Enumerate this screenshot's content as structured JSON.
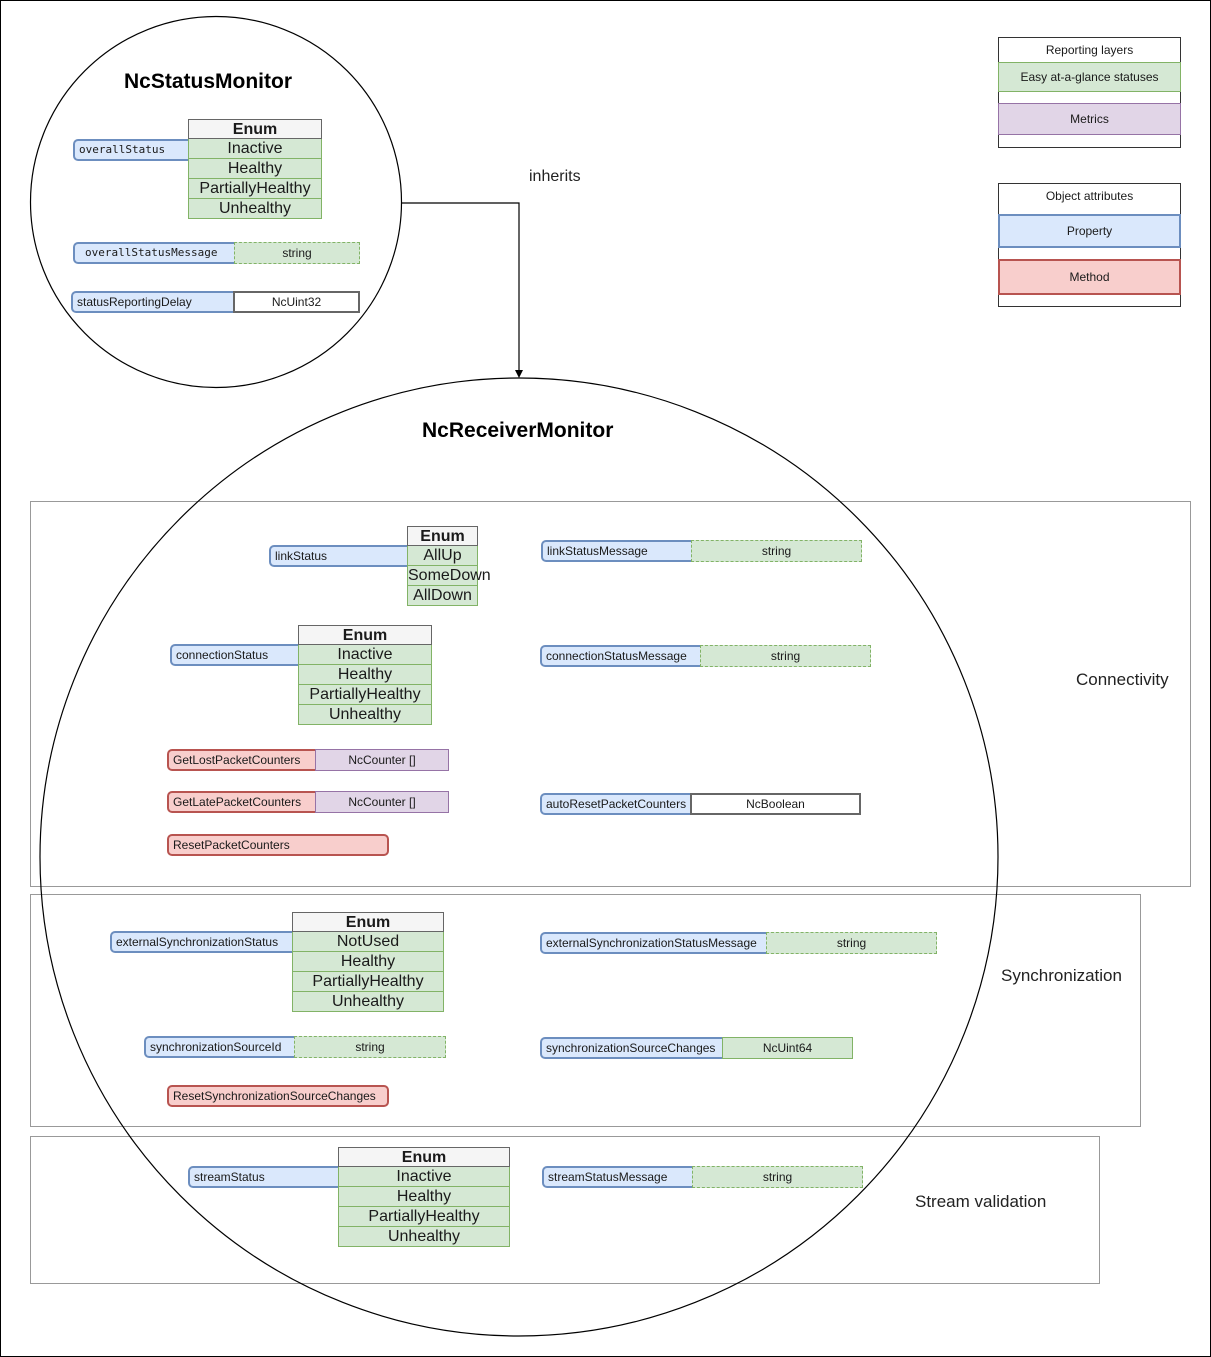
{
  "diagram": {
    "inherits_label": "inherits",
    "base_class": {
      "title": "NcStatusMonitor",
      "overallStatus": {
        "name": "overallStatus",
        "enum_header": "Enum",
        "values": [
          "Inactive",
          "Healthy",
          "PartiallyHealthy",
          "Unhealthy"
        ]
      },
      "overallStatusMessage": {
        "name": "overallStatusMessage",
        "type": "string"
      },
      "statusReportingDelay": {
        "name": "statusReportingDelay",
        "type": "NcUint32"
      }
    },
    "derived_class": {
      "title": "NcReceiverMonitor",
      "sections": {
        "connectivity": {
          "label": "Connectivity",
          "linkStatus": {
            "name": "linkStatus",
            "enum_header": "Enum",
            "values": [
              "AllUp",
              "SomeDown",
              "AllDown"
            ]
          },
          "linkStatusMessage": {
            "name": "linkStatusMessage",
            "type": "string"
          },
          "connectionStatus": {
            "name": "connectionStatus",
            "enum_header": "Enum",
            "values": [
              "Inactive",
              "Healthy",
              "PartiallyHealthy",
              "Unhealthy"
            ]
          },
          "connectionStatusMessage": {
            "name": "connectionStatusMessage",
            "type": "string"
          },
          "getLostPacketCounters": {
            "name": "GetLostPacketCounters",
            "type": "NcCounter []"
          },
          "getLatePacketCounters": {
            "name": "GetLatePacketCounters",
            "type": "NcCounter []"
          },
          "resetPacketCounters": {
            "name": "ResetPacketCounters"
          },
          "autoResetPacketCounters": {
            "name": "autoResetPacketCounters",
            "type": "NcBoolean"
          }
        },
        "synchronization": {
          "label": "Synchronization",
          "externalSynchronizationStatus": {
            "name": "externalSynchronizationStatus",
            "enum_header": "Enum",
            "values": [
              "NotUsed",
              "Healthy",
              "PartiallyHealthy",
              "Unhealthy"
            ]
          },
          "externalSynchronizationStatusMessage": {
            "name": "externalSynchronizationStatusMessage",
            "type": "string"
          },
          "synchronizationSourceId": {
            "name": "synchronizationSourceId",
            "type": "string"
          },
          "synchronizationSourceChanges": {
            "name": "synchronizationSourceChanges",
            "type": "NcUint64"
          },
          "resetSynchronizationSourceChanges": {
            "name": "ResetSynchronizationSourceChanges"
          }
        },
        "stream_validation": {
          "label": "Stream validation",
          "streamStatus": {
            "name": "streamStatus",
            "enum_header": "Enum",
            "values": [
              "Inactive",
              "Healthy",
              "PartiallyHealthy",
              "Unhealthy"
            ]
          },
          "streamStatusMessage": {
            "name": "streamStatusMessage",
            "type": "string"
          }
        }
      }
    },
    "legend_reporting": {
      "title": "Reporting layers",
      "items": [
        "Easy at-a-glance statuses",
        "Metrics"
      ],
      "colors": [
        "#d5e8d4",
        "#e1d5e7"
      ]
    },
    "legend_attributes": {
      "title": "Object attributes",
      "items": [
        "Property",
        "Method"
      ],
      "colors": [
        "#dae8fc",
        "#f8cecc"
      ]
    }
  }
}
